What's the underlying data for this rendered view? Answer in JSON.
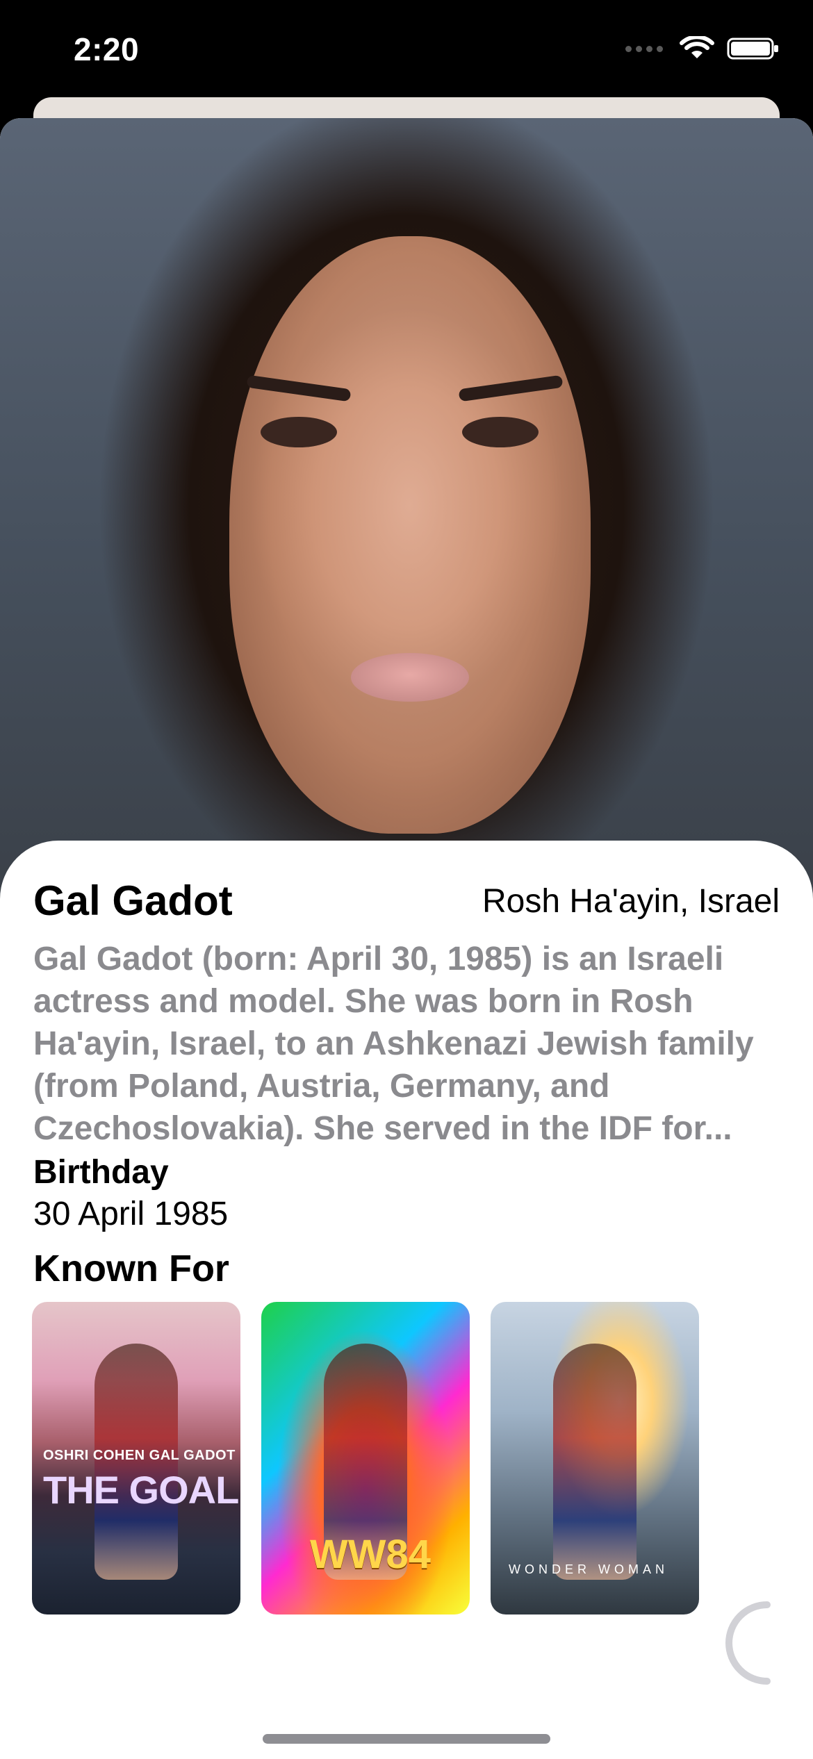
{
  "status_bar": {
    "time": "2:20"
  },
  "person": {
    "name": "Gal Gadot",
    "place_of_birth": "Rosh Ha'ayin, Israel",
    "bio": "Gal Gadot (born: April 30, 1985) is an Israeli actress and model. She was born in Rosh Ha'ayin, Israel, to an Ashkenazi Jewish family (from Poland, Austria, Germany, and Czechoslovakia). She served in the IDF for...",
    "birthday_label": "Birthday",
    "birthday_value": "30 April 1985"
  },
  "known_for": {
    "label": "Known For",
    "posters": [
      {
        "top_text": "OSHRI COHEN   GAL GADOT",
        "title": "THE GOAL"
      },
      {
        "title": "WW84"
      },
      {
        "title": "WONDER WOMAN"
      }
    ]
  },
  "colors": {
    "bio_text": "#8a8a8e",
    "accent": "#000000"
  },
  "icons": [
    "wifi-icon",
    "battery-icon",
    "signal-icon",
    "loading-spinner-icon"
  ]
}
